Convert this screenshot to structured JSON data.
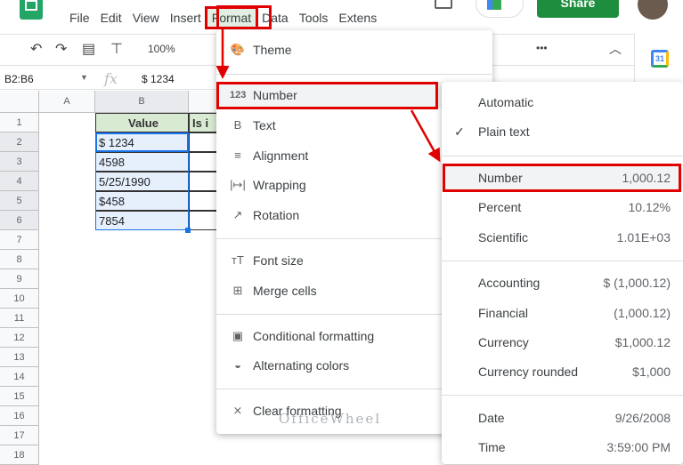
{
  "menubar": {
    "items": [
      "File",
      "Edit",
      "View",
      "Insert",
      "Format",
      "Data",
      "Tools",
      "Extens"
    ]
  },
  "header": {
    "share_label": "Share"
  },
  "toolbar": {
    "zoom": "100%",
    "more": "•••"
  },
  "formula_bar": {
    "name_box": "B2:B6",
    "fx": "fx",
    "value": "$ 1234"
  },
  "sheet": {
    "columns": [
      "A",
      "B"
    ],
    "c_header_partial": "Is i",
    "header_value": "Value",
    "rows": [
      "1",
      "2",
      "3",
      "4",
      "5",
      "6",
      "7",
      "8",
      "9",
      "10",
      "11",
      "12",
      "13",
      "14",
      "15",
      "16",
      "17",
      "18"
    ],
    "values": [
      "$ 1234",
      "4598",
      "5/25/1990",
      "$458",
      "7854"
    ]
  },
  "format_menu": {
    "items": [
      "Theme",
      "Number",
      "Text",
      "Alignment",
      "Wrapping",
      "Rotation",
      "Font size",
      "Merge cells",
      "Conditional formatting",
      "Alternating colors",
      "Clear formatting"
    ]
  },
  "number_submenu": {
    "items": [
      {
        "label": "Automatic",
        "value": ""
      },
      {
        "label": "Plain text",
        "value": "",
        "checked": true
      },
      {
        "label": "Number",
        "value": "1,000.12"
      },
      {
        "label": "Percent",
        "value": "10.12%"
      },
      {
        "label": "Scientific",
        "value": "1.01E+03"
      },
      {
        "label": "Accounting",
        "value": "$ (1,000.12)"
      },
      {
        "label": "Financial",
        "value": "(1,000.12)"
      },
      {
        "label": "Currency",
        "value": "$1,000.12"
      },
      {
        "label": "Currency rounded",
        "value": "$1,000"
      },
      {
        "label": "Date",
        "value": "9/26/2008"
      },
      {
        "label": "Time",
        "value": "3:59:00 PM"
      }
    ]
  },
  "watermark": "OfficeWheel",
  "colors": {
    "highlight": "#e10000",
    "share": "#1e8e3e"
  }
}
